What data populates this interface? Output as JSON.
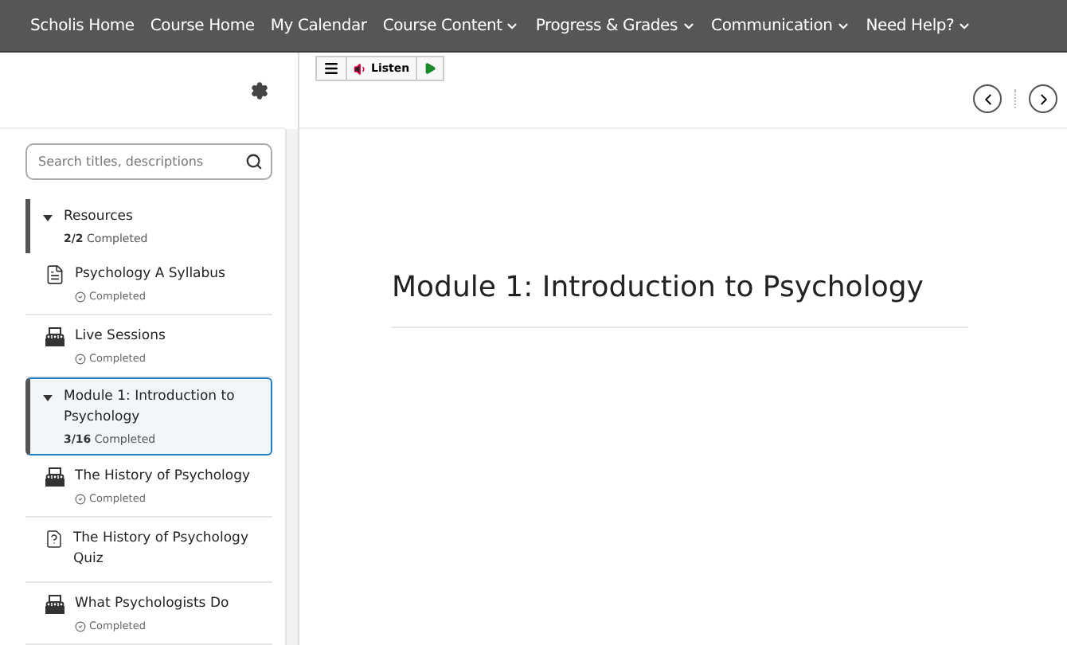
{
  "nav": {
    "items": [
      {
        "label": "Scholis Home",
        "has_menu": false
      },
      {
        "label": "Course Home",
        "has_menu": false
      },
      {
        "label": "My Calendar",
        "has_menu": false
      },
      {
        "label": "Course Content",
        "has_menu": true
      },
      {
        "label": "Progress & Grades",
        "has_menu": true
      },
      {
        "label": "Communication",
        "has_menu": true
      },
      {
        "label": "Need Help?",
        "has_menu": true
      }
    ]
  },
  "sidebar": {
    "search": {
      "placeholder": "Search titles, descriptions"
    },
    "tree": [
      {
        "title": "Resources",
        "progress": "**2/2** Completed",
        "expanded": true,
        "selected": false,
        "children": [
          {
            "kind": "document",
            "title": "Psychology A Syllabus",
            "status": "Completed"
          },
          {
            "kind": "live",
            "title": "Live Sessions",
            "status": "Completed"
          }
        ]
      },
      {
        "title": "Module 1: Introduction to Psychology",
        "progress": "**3/16** Completed",
        "expanded": true,
        "selected": true,
        "children": [
          {
            "kind": "live",
            "title": "The History of Psychology",
            "status": "Completed"
          },
          {
            "kind": "quiz",
            "title": "The History of Psychology Quiz"
          },
          {
            "kind": "live",
            "title": "What Psychologists Do",
            "status": "Completed"
          }
        ]
      }
    ]
  },
  "toolbar": {
    "listen": "Listen"
  },
  "content": {
    "title": "Module 1: Introduction to Psychology"
  }
}
